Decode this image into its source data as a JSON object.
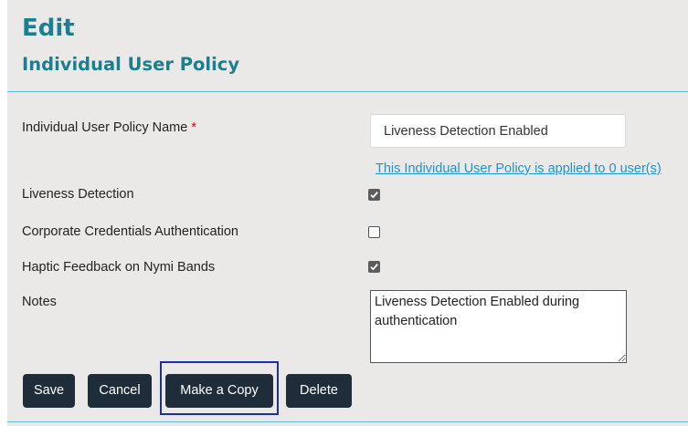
{
  "header": {
    "title": "Edit",
    "subtitle": "Individual User Policy"
  },
  "form": {
    "name_field": {
      "label": "Individual User Policy Name",
      "required_mark": "*",
      "value": "Liveness Detection Enabled"
    },
    "usage_link": "This Individual User Policy is applied to 0 user(s)",
    "options": [
      {
        "label": "Liveness Detection",
        "checked": true
      },
      {
        "label": "Corporate Credentials Authentication",
        "checked": false
      },
      {
        "label": "Haptic Feedback on Nymi Bands",
        "checked": true
      }
    ],
    "notes": {
      "label": "Notes",
      "value": "Liveness Detection Enabled during authentication"
    }
  },
  "actions": {
    "save_label": "Save",
    "cancel_label": "Cancel",
    "copy_label": "Make a Copy",
    "delete_label": "Delete"
  },
  "colors": {
    "heading": "#1a7f91",
    "link": "#1a95d1",
    "button": "#1f2d3b",
    "focus_ring": "#1a2fa3",
    "divider": "#5bbccb",
    "panel_background": "#ebe9e8"
  }
}
